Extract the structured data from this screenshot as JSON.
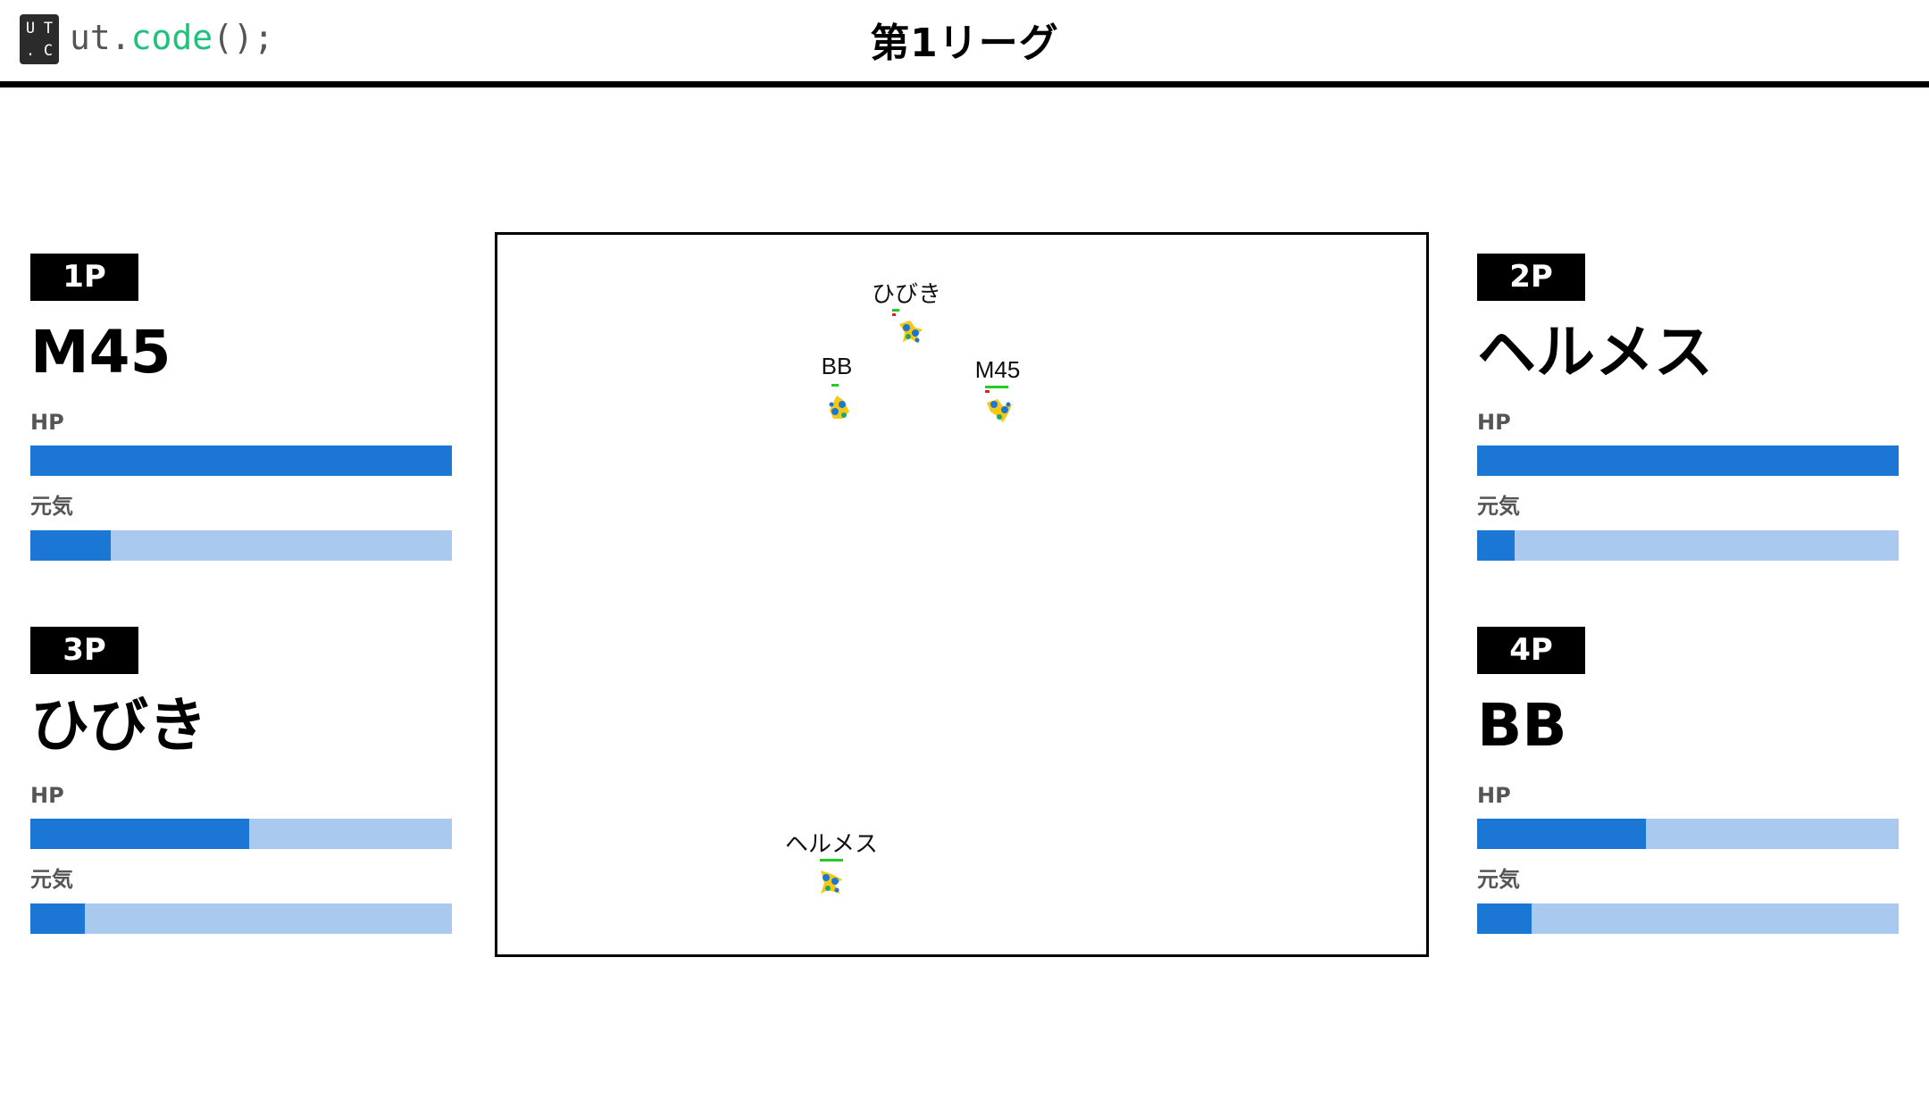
{
  "header": {
    "logo_icon_chars": [
      "U",
      "T",
      ".",
      "C"
    ],
    "logo_prefix": "ut.",
    "logo_accent": "code",
    "logo_suffix": "();",
    "title": "第1リーグ"
  },
  "colors": {
    "bar_fill": "#1c76d4",
    "bar_track": "#a9caee",
    "mini_hp": "#22cc22",
    "mini_genki": "#e02020",
    "logo_accent": "#1ec27a"
  },
  "labels": {
    "hp": "HP",
    "genki": "元気"
  },
  "players": [
    {
      "badge": "1P",
      "name": "M45",
      "hp": 1.0,
      "genki": 0.19
    },
    {
      "badge": "2P",
      "name": "ヘルメス",
      "hp": 1.0,
      "genki": 0.09
    },
    {
      "badge": "3P",
      "name": "ひびき",
      "hp": 0.52,
      "genki": 0.13
    },
    {
      "badge": "4P",
      "name": "BB",
      "hp": 0.4,
      "genki": 0.13
    }
  ],
  "arena": {
    "units": [
      {
        "name": "ひびき",
        "hp": 0.3,
        "genki": 0.15
      },
      {
        "name": "BB",
        "hp": 0.3,
        "genki": 0.0
      },
      {
        "name": "M45",
        "hp": 1.0,
        "genki": 0.2
      },
      {
        "name": "ヘルメス",
        "hp": 1.0,
        "genki": 0.0
      }
    ]
  }
}
